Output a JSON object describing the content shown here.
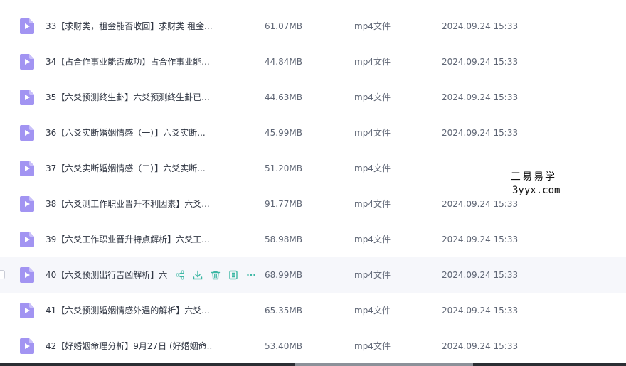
{
  "files": [
    {
      "name": "33【求财类，租金能否收回】求财类 租金...",
      "size": "61.07MB",
      "type": "mp4文件",
      "date": "2024.09.24 15:33"
    },
    {
      "name": "34【占合作事业能否成功】占合作事业能...",
      "size": "44.84MB",
      "type": "mp4文件",
      "date": "2024.09.24 15:33"
    },
    {
      "name": "35【六爻预测终生卦】六爻预测终生卦已...",
      "size": "44.63MB",
      "type": "mp4文件",
      "date": "2024.09.24 15:33"
    },
    {
      "name": "36【六爻实断婚姻情感（一）】六爻实断...",
      "size": "45.99MB",
      "type": "mp4文件",
      "date": "2024.09.24 15:33"
    },
    {
      "name": "37【六爻实断婚姻情感（二）】六爻实断...",
      "size": "51.20MB",
      "type": "mp4文件",
      "date": ""
    },
    {
      "name": "38【六爻测工作职业晋升不利因素】六爻...",
      "size": "91.77MB",
      "type": "mp4文件",
      "date": "2024.09.24 15:33"
    },
    {
      "name": "39【六爻工作职业晋升特点解析】六爻工...",
      "size": "58.98MB",
      "type": "mp4文件",
      "date": "2024.09.24 15:33"
    },
    {
      "name": "40【六爻预测出行吉凶解析】六",
      "size": "68.99MB",
      "type": "mp4文件",
      "date": "2024.09.24 15:33"
    },
    {
      "name": "41【六爻预测婚姻情感外遇的解析】六爻...",
      "size": "65.35MB",
      "type": "mp4文件",
      "date": "2024.09.24 15:33"
    },
    {
      "name": "42【好婚姻命理分析】9月27日 (好婚姻命...",
      "size": "53.40MB",
      "type": "mp4文件",
      "date": "2024.09.24 15:33"
    }
  ],
  "watermark": {
    "cn": "三易易学",
    "en": "3yyx.com"
  },
  "icons": {
    "file": "video-file-icon",
    "share": "share-icon",
    "download": "download-icon",
    "delete": "trash-icon",
    "info": "info-icon",
    "more": "more-icon"
  },
  "colors": {
    "file_icon": "#9b8cf0",
    "action_icon": "#3cb7a4",
    "hover_row": "#f6f7fb"
  }
}
